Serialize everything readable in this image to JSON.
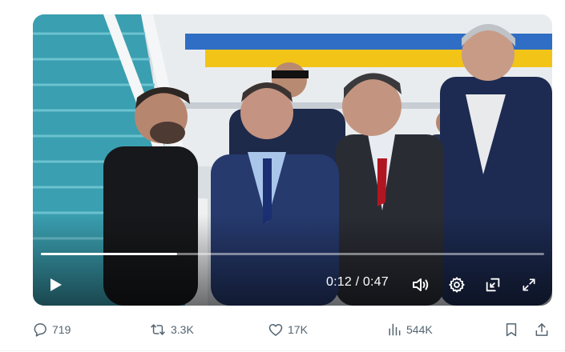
{
  "video": {
    "progress_percent": 27,
    "time_current": "0:12",
    "time_separator": " / ",
    "time_total": "0:47"
  },
  "actions": {
    "replies": "719",
    "reposts": "3.3K",
    "likes": "17K",
    "views": "544K"
  },
  "icons": {
    "play": "play-icon",
    "volume": "volume-icon",
    "settings": "gear-icon",
    "pip": "picture-in-picture-icon",
    "fullscreen": "fullscreen-icon",
    "reply": "reply-icon",
    "repost": "repost-icon",
    "like": "heart-icon",
    "views": "views-chart-icon",
    "bookmark": "bookmark-icon",
    "share": "share-icon"
  },
  "colors": {
    "action_gray": "#536471",
    "video_overlay_text": "#ffffff"
  }
}
